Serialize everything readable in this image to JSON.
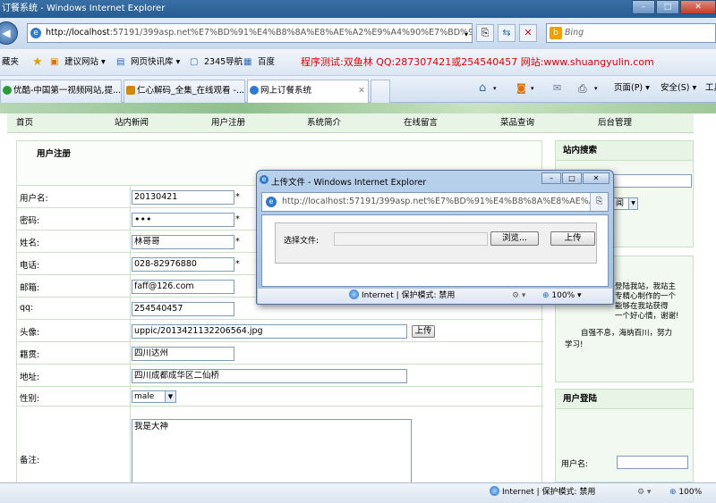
{
  "window": {
    "title": "订餐系统 - Windows Internet Explorer"
  },
  "toolbar": {
    "address": "http://localhost:57191/399asp.net%E7%BD%91%E4%B8%8A%E8%AE%A2%E9%A4%90%E7%BD%91%E",
    "address_host": "http://localhost",
    "address_rest": ":57191/399asp.net%E7%BD%91%E4%B8%8A%E8%AE%A2%E9%A4%90%E7%BD%91%E",
    "search_placeholder": "Bing"
  },
  "favorites": {
    "label": "藏夹",
    "items": [
      "建议网站 ▾",
      "网页快讯库 ▾",
      "2345导航",
      "百度"
    ],
    "promo": "程序测试:双鱼林 QQ:287307421或254540457 网站:www.shuangyulin.com"
  },
  "tabs": [
    {
      "label": "优酷-中国第一视频网站,提...",
      "active": false
    },
    {
      "label": "仁心解码_全集_在线观看 -...",
      "active": false
    },
    {
      "label": "网上订餐系统",
      "active": true
    }
  ],
  "commandbar": {
    "page": "页面(P) ▾",
    "safety": "安全(S) ▾",
    "tools": "工具"
  },
  "site": {
    "menu": [
      "首页",
      "站内新闻",
      "用户注册",
      "系统简介",
      "在线留言",
      "菜品查询",
      "后台管理"
    ],
    "section_title": "用户注册",
    "form": {
      "username_label": "用户名:",
      "username": "20130421",
      "password_label": "密码:",
      "password": "•••",
      "name_label": "姓名:",
      "name": "林哥哥",
      "phone_label": "电话:",
      "phone": "028-82976880",
      "email_label": "邮箱:",
      "email": "faff@126.com",
      "qq_label": "qq:",
      "qq": "254540457",
      "avatar_label": "头像:",
      "avatar": "uppic/2013421132206564.jpg",
      "upload": "上传",
      "hometown_label": "籍贯:",
      "hometown": "四川达州",
      "address_label": "地址:",
      "address": "四川成都成华区二仙桥",
      "gender_label": "性别:",
      "gender": "male",
      "remark_label": "备注:",
      "remark": "我是大神",
      "required": "*"
    },
    "sidebar": {
      "search_title": "站内搜索",
      "search_select_fragment": "闻",
      "welcome_text": "登陆我站，我站主\n专精心制作的一个\n能够在我站获得\n一个好心情，谢谢!",
      "welcome_text2": "自强不息，海纳百川，努力\n学习!",
      "login_title": "用户登陆",
      "login_username_label": "用户名:"
    }
  },
  "dialog": {
    "title": "上传文件 - Windows Internet Explorer",
    "address": "http://localhost:57191/399asp.net%E7%BD%91%E4%B8%8A%E8%AE%A2%E9%A4%90%E",
    "file_label": "选择文件:",
    "browse": "浏览...",
    "upload": "上传",
    "status_zone": "Internet | 保护模式: 禁用",
    "zoom": "100%"
  },
  "statusbar": {
    "zone": "Internet | 保护模式: 禁用",
    "zoom": "100%"
  }
}
